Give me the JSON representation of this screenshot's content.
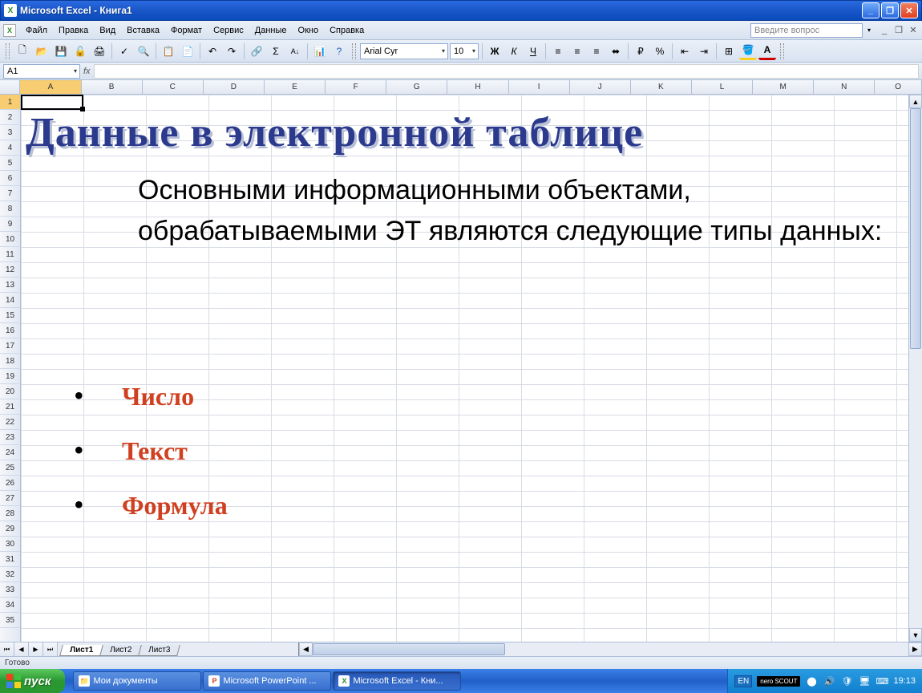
{
  "titlebar": {
    "app_name": "Microsoft Excel",
    "doc_name": "Книга1"
  },
  "menu": {
    "items": [
      "Файл",
      "Правка",
      "Вид",
      "Вставка",
      "Формат",
      "Сервис",
      "Данные",
      "Окно",
      "Справка"
    ],
    "help_placeholder": "Введите вопрос"
  },
  "toolbar": {
    "font_name": "Arial Cyr",
    "font_size": "10"
  },
  "formula": {
    "name_box": "A1",
    "fx": "fx"
  },
  "columns": [
    "A",
    "B",
    "C",
    "D",
    "E",
    "F",
    "G",
    "H",
    "I",
    "J",
    "K",
    "L",
    "M",
    "N",
    "O"
  ],
  "rows_visible": 35,
  "active_cell": "A1",
  "sheets": {
    "tabs": [
      "Лист1",
      "Лист2",
      "Лист3"
    ],
    "active": 0
  },
  "status": {
    "ready": "Готово"
  },
  "overlay": {
    "title": "Данные в электронной таблице",
    "body": "Основными информационными объектами, обрабатываемыми ЭТ являются следующие типы данных:",
    "bullets": [
      "Число",
      "Текст",
      "Формула"
    ]
  },
  "taskbar": {
    "start": "пуск",
    "items": [
      {
        "label": "Мои документы",
        "type": "folder",
        "active": false
      },
      {
        "label": "Microsoft PowerPoint ...",
        "type": "ppt",
        "active": false
      },
      {
        "label": "Microsoft Excel - Кни...",
        "type": "xls",
        "active": true
      }
    ],
    "lang": "EN",
    "nero": "nero SCOUT",
    "clock": "19:13"
  }
}
